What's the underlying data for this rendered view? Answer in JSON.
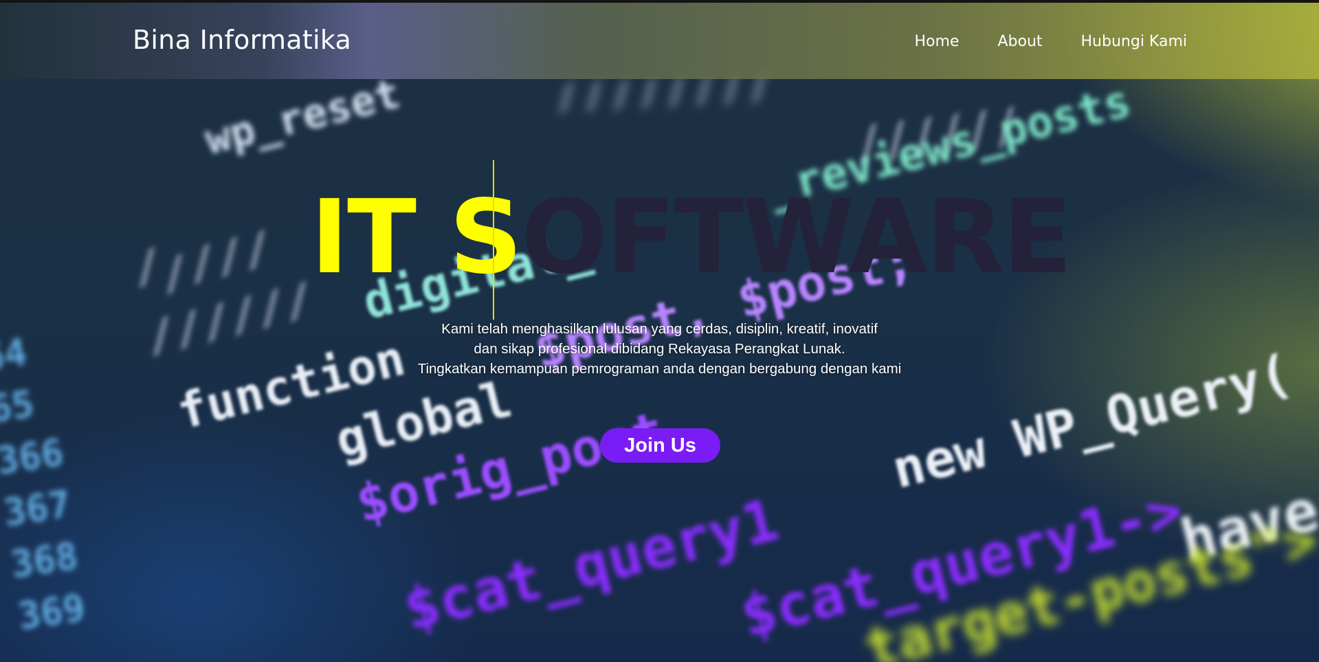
{
  "brand": "Bina Informatika",
  "nav": [
    "Home",
    "About",
    "Hubungi Kami"
  ],
  "hero": {
    "highlight": "IT S",
    "rest": "OFTWARE",
    "tagline": [
      "Kami telah menghasilkan lulusan yang cerdas, disiplin, kreatif, inovatif",
      "dan sikap profesional dibidang Rekayasa Perangkat Lunak.",
      "Tingkatkan kemampuan pemrograman anda dengan bergabung dengan kami"
    ],
    "cta": "Join Us"
  },
  "colors": {
    "highlight": "#ffff00",
    "title_dark": "#23223a",
    "button": "#7a1cf5"
  }
}
